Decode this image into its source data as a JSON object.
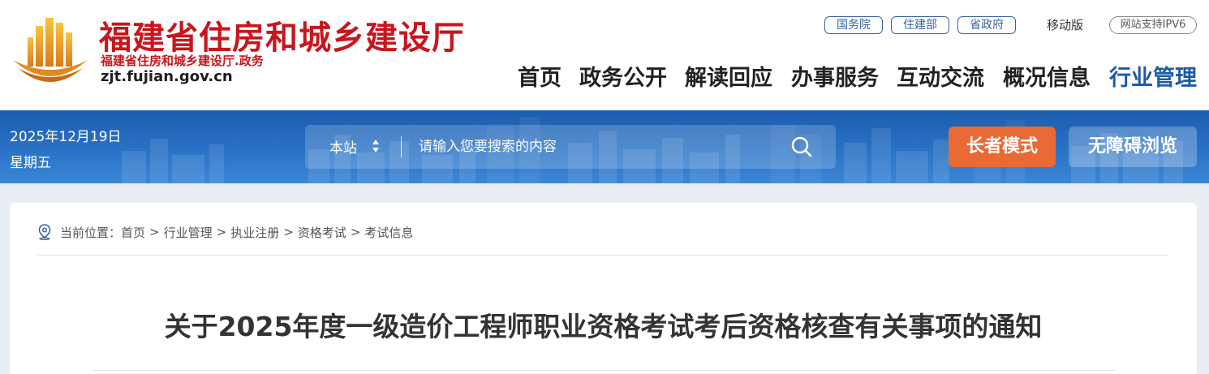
{
  "header": {
    "site_title": "福建省住房和城乡建设厅",
    "site_subtitle": "福建省住房和城乡建设厅.政务",
    "domain": "zjt.fujian.gov.cn",
    "quick_links": [
      "国务院",
      "住建部",
      "省政府"
    ],
    "mobile_label": "移动版",
    "ipv6_label": "网站支持IPV6",
    "nav": [
      "首页",
      "政务公开",
      "解读回应",
      "办事服务",
      "互动交流",
      "概况信息",
      "行业管理"
    ],
    "active_nav": "行业管理"
  },
  "banner": {
    "date": "2025年12月19日",
    "weekday": "星期五",
    "search": {
      "scope": "本站",
      "placeholder": "请输入您要搜索的内容"
    },
    "elder_mode_label": "长者模式",
    "accessible_label": "无障碍浏览"
  },
  "content": {
    "breadcrumb_prefix": "当前位置：",
    "breadcrumb": [
      "首页",
      "行业管理",
      "执业注册",
      "资格考试",
      "考试信息"
    ],
    "breadcrumb_separator": ">",
    "article_title": "关于2025年度一级造价工程师职业资格考试考后资格核查有关事项的通知"
  },
  "colors": {
    "brand_red": "#c8161d",
    "brand_blue": "#1d5ba6",
    "elder_button": "#e96a34"
  }
}
